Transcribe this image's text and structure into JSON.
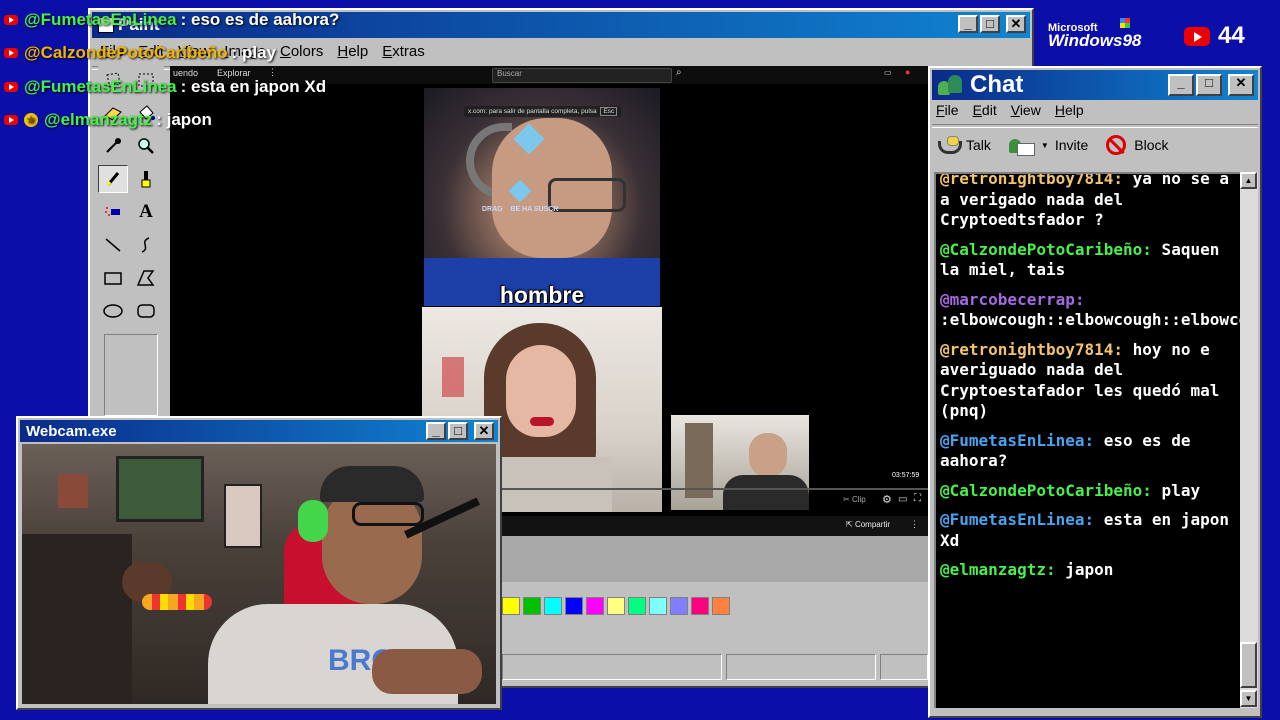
{
  "overlay_chat": [
    {
      "user": "@FumetasEnLinea",
      "text": ": eso es de aahora?",
      "color": "#47f04a",
      "badge": "yt"
    },
    {
      "user": "@CalzondePotoCaribeño",
      "text": ": play",
      "color": "#f2b400",
      "badge": "yt"
    },
    {
      "user": "@FumetasEnLinea",
      "text": ": esta en japon Xd",
      "color": "#47f04a",
      "badge": "yt"
    },
    {
      "user": "@elmanzagtz",
      "text": ": japon",
      "color": "#47f04a",
      "badge": "star"
    }
  ],
  "branding": {
    "logo_top": "Microsoft",
    "logo_main": "Windows98",
    "viewer_count": "44"
  },
  "paint": {
    "title": "Paint",
    "menu": [
      "File",
      "Edit",
      "View",
      "Image",
      "Colors",
      "Help",
      "Extras"
    ],
    "tools": [
      "free-select",
      "rect-select",
      "eraser",
      "fill",
      "eyedropper",
      "magnifier",
      "pencil",
      "brush",
      "airbrush",
      "text",
      "line",
      "curve",
      "rectangle",
      "polygon",
      "ellipse",
      "rounded-rectangle"
    ],
    "palette": [
      "#ffff00",
      "#00c000",
      "#00ffff",
      "#0000ff",
      "#ff00ff",
      "#ffff80",
      "#00ff80",
      "#80ffff",
      "#8080ff",
      "#ff0080",
      "#ff8040"
    ]
  },
  "browser": {
    "nav_items": [
      "uendo",
      "Explorar"
    ],
    "search_placeholder": "Buscar",
    "fullscreen_hint": "x.com: para salir de pantalla completa, pulsa",
    "esc_key": "Esc",
    "caption": "hombre",
    "sub_text": "DRAG    BE HA SUSCR",
    "timestamp": "03:57:59",
    "clip_label": "Clip",
    "share_label": "Compartir"
  },
  "webcam": {
    "title": "Webcam.exe",
    "shirt_text": "BROKE"
  },
  "chat_window": {
    "title": "Chat",
    "menu": [
      "File",
      "Edit",
      "View",
      "Help"
    ],
    "toolbar": {
      "talk": "Talk",
      "invite": "Invite",
      "block": "Block"
    },
    "messages": [
      {
        "user": "@retronightboy7814:",
        "text": " ya no se a a verigado nada del Cryptoedtsfador ?",
        "color": "#f2c46d"
      },
      {
        "user": "@CalzondePotoCaribeño:",
        "text": " Saquen la miel, tais",
        "color": "#47f04a"
      },
      {
        "user": "@marcobecerrap:",
        "text": " :elbowcough::elbowcough::elbowcough::elbowcough:",
        "color": "#a56ae0"
      },
      {
        "user": "@retronightboy7814:",
        "text": " hoy no e averiguado nada del Cryptoestafador les quedó mal (pnq)",
        "color": "#f2c46d"
      },
      {
        "user": "@FumetasEnLinea:",
        "text": " eso es de aahora?",
        "color": "#4aa3f0"
      },
      {
        "user": "@CalzondePotoCaribeño:",
        "text": " play",
        "color": "#47f04a"
      },
      {
        "user": "@FumetasEnLinea:",
        "text": " esta en japon Xd",
        "color": "#4aa3f0"
      },
      {
        "user": "@elmanzagtz:",
        "text": " japon",
        "color": "#47f04a"
      }
    ]
  }
}
